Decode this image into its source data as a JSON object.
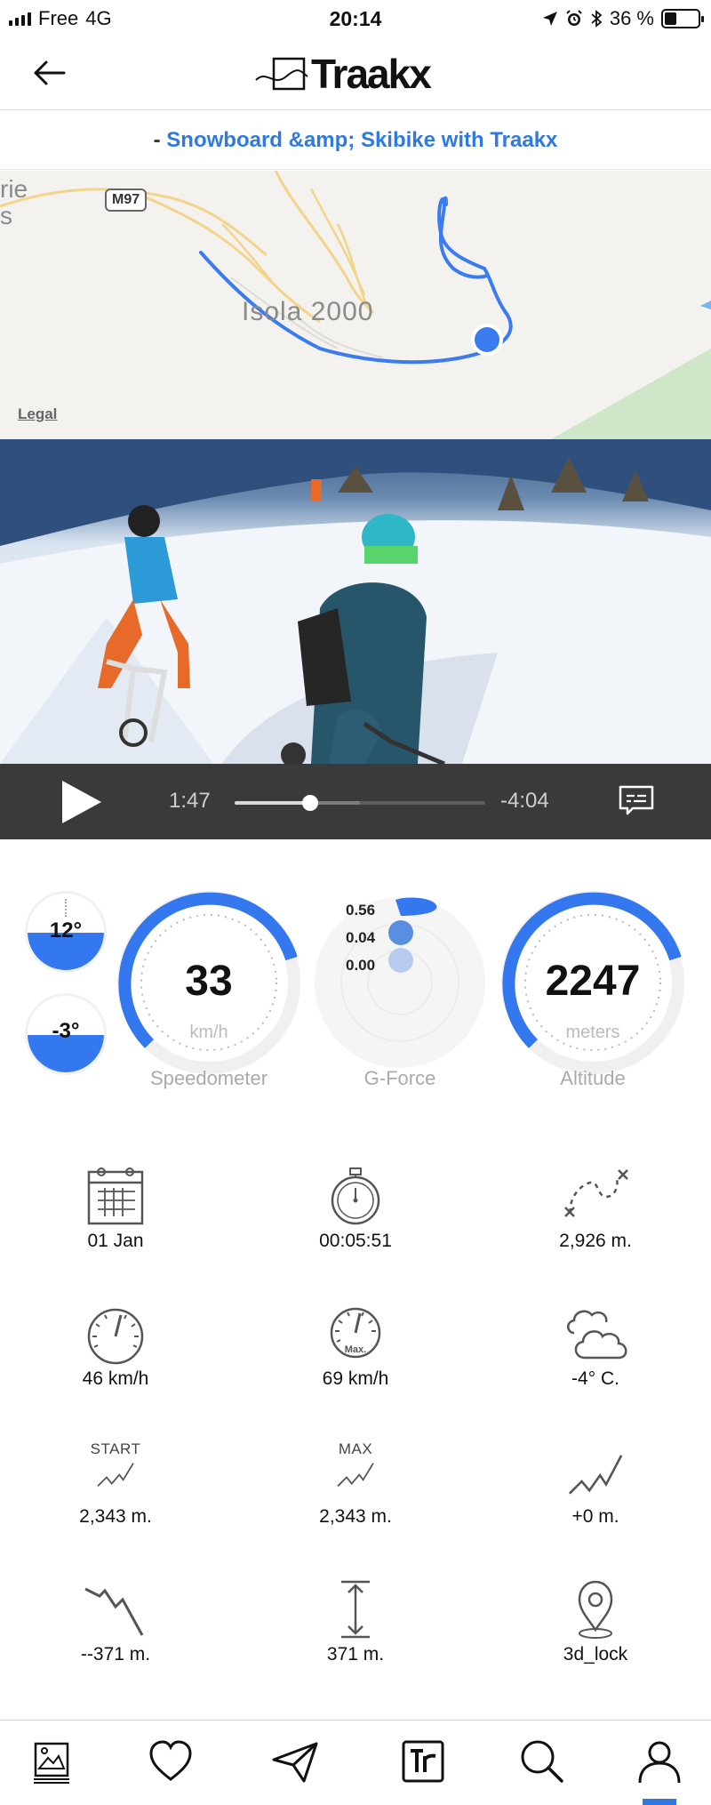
{
  "status_bar": {
    "carrier": "Free",
    "network": "4G",
    "time": "20:14",
    "battery": "36 %",
    "battery_fraction": 0.36
  },
  "header": {
    "brand": "Traakx",
    "back_icon": "arrow-left-icon"
  },
  "subtitle": {
    "prefix": "-",
    "title": "Snowboard &amp; Skibike with Traakx"
  },
  "map": {
    "place": "Isola 2000",
    "road": "M97",
    "edge_text": "rie\ns",
    "legal": "Legal"
  },
  "video": {
    "current_time": "1:47",
    "remaining_time": "-4:04",
    "progress": 0.3,
    "buffered": 0.5
  },
  "gauges": {
    "tilt_top": {
      "value": "12°"
    },
    "tilt_bottom": {
      "value": "-3°"
    },
    "speedometer": {
      "value": "33",
      "unit": "km/h",
      "label": "Speedometer"
    },
    "gforce": {
      "label": "G-Force",
      "values": [
        "0.56",
        "0.04",
        "0.00"
      ]
    },
    "altitude": {
      "value": "2247",
      "unit": "meters",
      "label": "Altitude"
    }
  },
  "stats": [
    {
      "icon": "calendar-icon",
      "caption": "",
      "value": "01 Jan"
    },
    {
      "icon": "stopwatch-icon",
      "caption": "",
      "value": "00:05:51"
    },
    {
      "icon": "route-distance-icon",
      "caption": "",
      "value": "2,926 m."
    },
    {
      "icon": "speedometer-avg-icon",
      "caption": "",
      "value": "46 km/h"
    },
    {
      "icon": "speedometer-max-icon",
      "caption": "Max.",
      "value": "69 km/h"
    },
    {
      "icon": "weather-cloud-icon",
      "caption": "",
      "value": "-4° C."
    },
    {
      "icon": "elevation-start-icon",
      "caption": "START",
      "value": "2,343 m."
    },
    {
      "icon": "elevation-max-icon",
      "caption": "MAX",
      "value": "2,343 m."
    },
    {
      "icon": "elevation-gain-icon",
      "caption": "",
      "value": "+0 m."
    },
    {
      "icon": "elevation-loss-icon",
      "caption": "",
      "value": "--371 m."
    },
    {
      "icon": "vertical-range-icon",
      "caption": "",
      "value": "371 m."
    },
    {
      "icon": "location-pin-icon",
      "caption": "",
      "value": "3d_lock"
    }
  ],
  "tabbar": {
    "tabs": [
      "gallery-icon",
      "heart-icon",
      "send-icon",
      "traakx-icon",
      "search-icon",
      "profile-icon"
    ],
    "active": "profile-icon",
    "accent": "#2f7ae0"
  },
  "colors": {
    "accent": "#2f7ae0",
    "gauge_blue": "#3478f0",
    "track": "#3a7bf0"
  }
}
